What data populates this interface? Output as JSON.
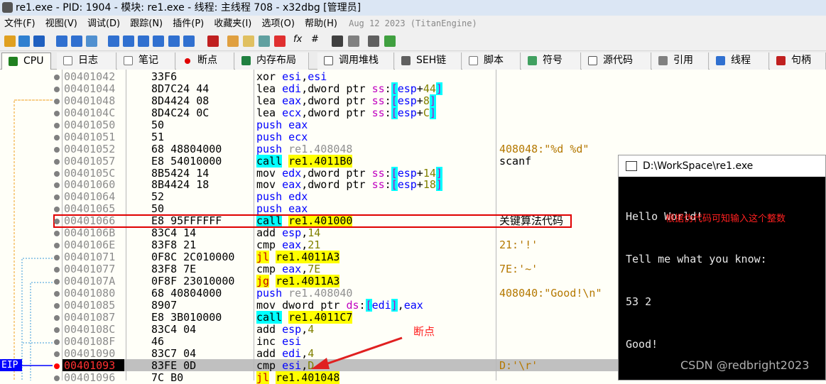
{
  "window": {
    "title": "re1.exe - PID: 1904 - 模块: re1.exe - 线程: 主线程 708 - x32dbg [管理员]"
  },
  "menu": [
    "文件(F)",
    "视图(V)",
    "调试(D)",
    "跟踪(N)",
    "插件(P)",
    "收藏夹(I)",
    "选项(O)",
    "帮助(H)"
  ],
  "menu_date": "Aug 12 2023 (TitanEngine)",
  "toolbar": {
    "fx": "fx",
    "hash": "#"
  },
  "tabs": [
    "CPU",
    "日志",
    "笔记",
    "断点",
    "内存布局",
    "调用堆栈",
    "SEH链",
    "脚本",
    "符号",
    "源代码",
    "引用",
    "线程",
    "句柄"
  ],
  "rows": [
    {
      "addr": "00401042",
      "bytes": "33F6",
      "dis": "xor esi,esi",
      "cmt": ""
    },
    {
      "addr": "00401044",
      "bytes": "8D7C24 44",
      "dis": "lea edi,dword ptr ss:[esp+44]",
      "cmt": ""
    },
    {
      "addr": "00401048",
      "bytes": "8D4424 08",
      "dis": "lea eax,dword ptr ss:[esp+8]",
      "cmt": ""
    },
    {
      "addr": "0040104C",
      "bytes": "8D4C24 0C",
      "dis": "lea ecx,dword ptr ss:[esp+C]",
      "cmt": ""
    },
    {
      "addr": "00401050",
      "bytes": "50",
      "dis": "push eax",
      "cmt": ""
    },
    {
      "addr": "00401051",
      "bytes": "51",
      "dis": "push ecx",
      "cmt": ""
    },
    {
      "addr": "00401052",
      "bytes": "68 48804000",
      "dis": "push re1.408048",
      "cmt": "408048:\"%d %d\""
    },
    {
      "addr": "00401057",
      "bytes": "E8 54010000",
      "dis": "call re1.4011B0",
      "cmt": "scanf"
    },
    {
      "addr": "0040105C",
      "bytes": "8B5424 14",
      "dis": "mov edx,dword ptr ss:[esp+14]",
      "cmt": ""
    },
    {
      "addr": "00401060",
      "bytes": "8B4424 18",
      "dis": "mov eax,dword ptr ss:[esp+18]",
      "cmt": ""
    },
    {
      "addr": "00401064",
      "bytes": "52",
      "dis": "push edx",
      "cmt": ""
    },
    {
      "addr": "00401065",
      "bytes": "50",
      "dis": "push eax",
      "cmt": ""
    },
    {
      "addr": "00401066",
      "bytes": "E8 95FFFFFF",
      "dis": "call re1.401000",
      "cmt": "关键算法代码"
    },
    {
      "addr": "0040106B",
      "bytes": "83C4 14",
      "dis": "add esp,14",
      "cmt": ""
    },
    {
      "addr": "0040106E",
      "bytes": "83F8 21",
      "dis": "cmp eax,21",
      "cmt": "21:'!'"
    },
    {
      "addr": "00401071",
      "bytes": "0F8C 2C010000",
      "dis": "jl re1.4011A3",
      "cmt": ""
    },
    {
      "addr": "00401077",
      "bytes": "83F8 7E",
      "dis": "cmp eax,7E",
      "cmt": "7E:'~'"
    },
    {
      "addr": "0040107A",
      "bytes": "0F8F 23010000",
      "dis": "jg re1.4011A3",
      "cmt": ""
    },
    {
      "addr": "00401080",
      "bytes": "68 40804000",
      "dis": "push re1.408040",
      "cmt": "408040:\"Good!\\n\""
    },
    {
      "addr": "00401085",
      "bytes": "8907",
      "dis": "mov dword ptr ds:[edi],eax",
      "cmt": ""
    },
    {
      "addr": "00401087",
      "bytes": "E8 3B010000",
      "dis": "call re1.4011C7",
      "cmt": ""
    },
    {
      "addr": "0040108C",
      "bytes": "83C4 04",
      "dis": "add esp,4",
      "cmt": ""
    },
    {
      "addr": "0040108F",
      "bytes": "46",
      "dis": "inc esi",
      "cmt": ""
    },
    {
      "addr": "00401090",
      "bytes": "83C7 04",
      "dis": "add edi,4",
      "cmt": ""
    },
    {
      "addr": "00401093",
      "bytes": "83FE 0D",
      "dis": "cmp esi,D",
      "cmt": "D:'\\r'"
    },
    {
      "addr": "00401096",
      "bytes": "7C B0",
      "dis": "jl re1.401048",
      "cmt": ""
    }
  ],
  "eip_label": "EIP",
  "console": {
    "title": "D:\\WorkSpace\\re1.exe",
    "lines": [
      "Hello World!",
      "Tell me what you know:",
      "53 2",
      "Good!"
    ]
  },
  "annotations": {
    "console_note": "根据伪代码可知输入这个整数",
    "breakpoint_note": "断点"
  },
  "watermark": "CSDN @redbright2023",
  "colors": {
    "call_bg": "#00ffff",
    "jump_bg": "#ffff00",
    "eip_bg": "#0000ff",
    "box_red": "#e00000"
  }
}
